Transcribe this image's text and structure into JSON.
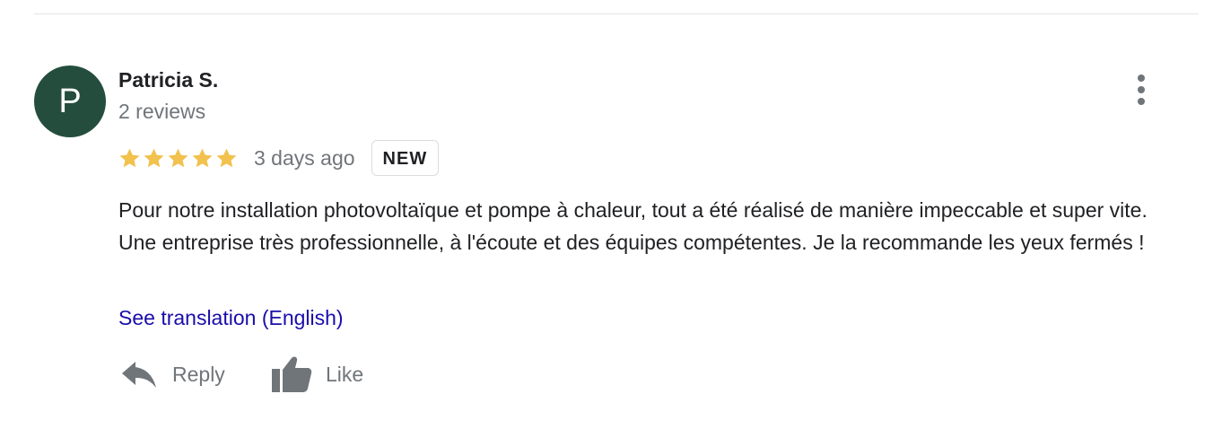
{
  "review": {
    "author": {
      "initial": "P",
      "name": "Patricia S.",
      "review_count": "2 reviews",
      "avatar_color": "#244d3d"
    },
    "rating": {
      "value": 5,
      "max": 5,
      "star_color": "#f2c14e"
    },
    "date": "3 days ago",
    "badge": "NEW",
    "text": "Pour notre installation photovoltaïque et pompe à chaleur, tout a été réalisé de manière impeccable et super vite. Une entreprise très professionnelle, à l'écoute et des équipes compétentes. Je la recommande les yeux fermés !",
    "translate_link": "See translation (English)",
    "link_color": "#1a0dab"
  },
  "actions": {
    "reply_label": "Reply",
    "reply_icon": "reply-icon",
    "like_label": "Like",
    "like_icon": "thumbs-up-icon"
  },
  "menu": {
    "icon": "more-vertical-icon"
  }
}
